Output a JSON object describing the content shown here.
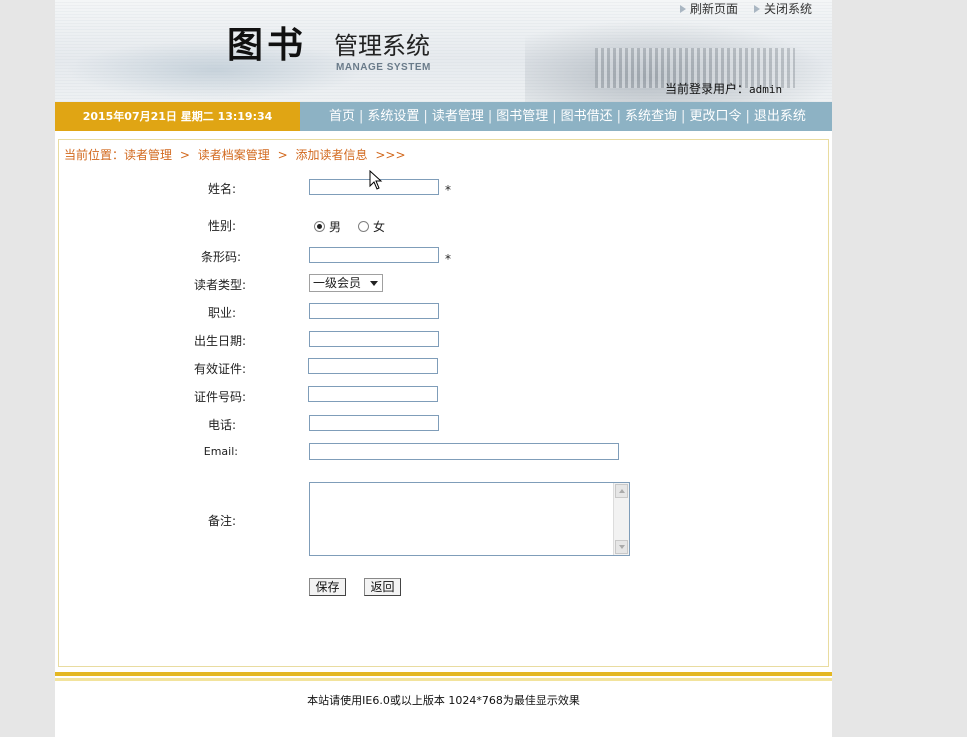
{
  "header": {
    "logo_main": "图书",
    "logo_sub": "管理系统",
    "logo_en": "MANAGE SYSTEM",
    "links": {
      "refresh": "刷新页面",
      "close": "关闭系统"
    },
    "user_label": "当前登录用户：",
    "user_name": "admin"
  },
  "navbar": {
    "datetime": "2015年07月21日 星期二 13:19:34",
    "menu": [
      "首页",
      "系统设置",
      "读者管理",
      "图书管理",
      "图书借还",
      "系统查询",
      "更改口令",
      "退出系统"
    ],
    "separator": "|"
  },
  "breadcrumb": {
    "prefix": "当前位置：",
    "items": [
      "读者管理",
      "读者档案管理",
      "添加读者信息"
    ],
    "sep": ">",
    "tail": ">>>"
  },
  "form": {
    "name_label": "姓名:",
    "gender_label": "性别:",
    "gender_male": "男",
    "gender_female": "女",
    "barcode_label": "条形码:",
    "reader_type_label": "读者类型:",
    "reader_type_value": "一级会员",
    "job_label": "职业:",
    "birth_label": "出生日期:",
    "id_type_label": "有效证件:",
    "id_no_label": "证件号码:",
    "phone_label": "电话:",
    "email_label": "Email:",
    "remark_label": "备注:",
    "required_mark": "*",
    "save": "保存",
    "back": "返回"
  },
  "footer": {
    "text": "本站请使用IE6.0或以上版本 1024*768为最佳显示效果"
  },
  "colors": {
    "nav_bg": "#8db2c4",
    "date_bg": "#e0a514",
    "crumb": "#d2691e",
    "footer_line": "#e4b722"
  }
}
